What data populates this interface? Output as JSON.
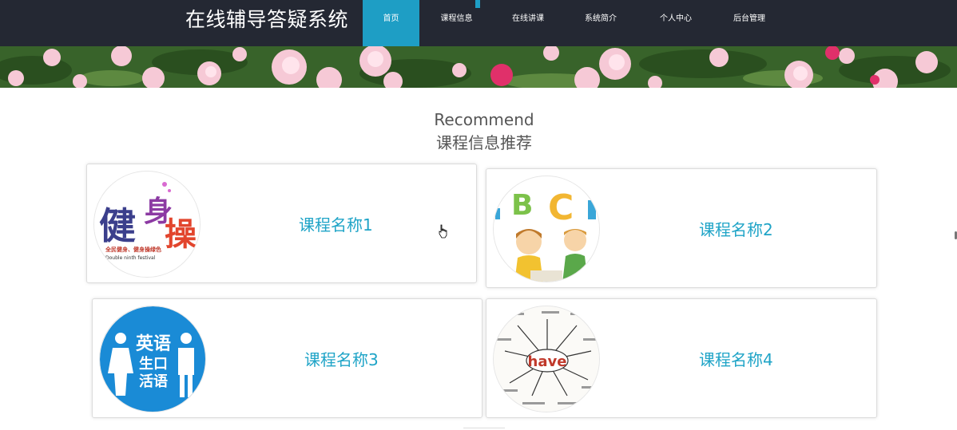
{
  "header": {
    "site_title": "在线辅导答疑系统",
    "nav": [
      {
        "label": "首页",
        "active": true
      },
      {
        "label": "课程信息",
        "active": false
      },
      {
        "label": "在线讲课",
        "active": false
      },
      {
        "label": "系统简介",
        "active": false
      },
      {
        "label": "个人中心",
        "active": false
      },
      {
        "label": "后台管理",
        "active": false
      }
    ]
  },
  "section": {
    "title_en": "Recommend",
    "title_cn": "课程信息推荐"
  },
  "courses": [
    {
      "name": "课程名称1",
      "image_text": [
        "健",
        "身",
        "操"
      ],
      "image_caption": "全民健身、健身操绿色",
      "image_caption2": "Double ninth festival"
    },
    {
      "name": "课程名称2",
      "image_text": [
        "B",
        "C"
      ]
    },
    {
      "name": "课程名称3",
      "image_text": [
        "英语",
        "生口",
        "活语"
      ]
    },
    {
      "name": "课程名称4",
      "image_text": [
        "have"
      ]
    }
  ],
  "colors": {
    "topbar": "#242833",
    "accent": "#1e9ec5",
    "course_name": "#1fa4c7"
  }
}
